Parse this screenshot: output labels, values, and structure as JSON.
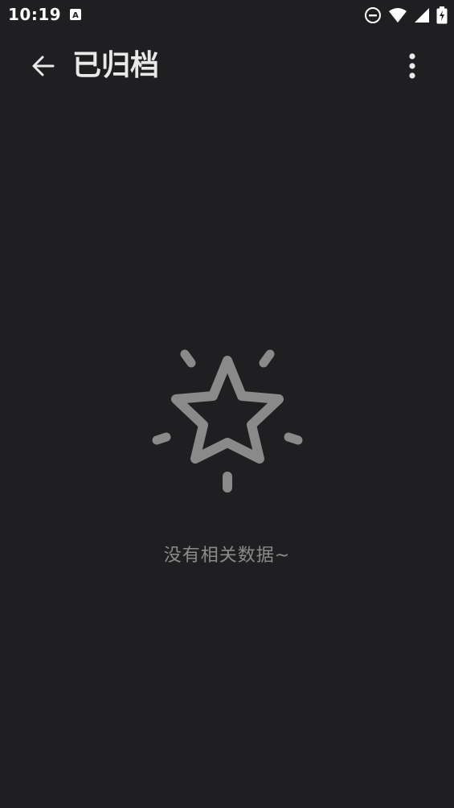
{
  "status_bar": {
    "time": "10:19",
    "app_icon_letter": "A",
    "icons": [
      "dnd-icon",
      "wifi-icon",
      "signal-icon",
      "battery-icon"
    ]
  },
  "toolbar": {
    "title": "已归档",
    "back_icon": "arrow-left-icon",
    "more_icon": "more-vertical-icon"
  },
  "empty_state": {
    "icon": "star-sparkle-icon",
    "message": "没有相关数据~"
  },
  "colors": {
    "background": "#1f1f21",
    "text_primary": "#e9e9e9",
    "text_secondary": "#8b8b8b",
    "icon_muted": "#8a8a8a"
  }
}
